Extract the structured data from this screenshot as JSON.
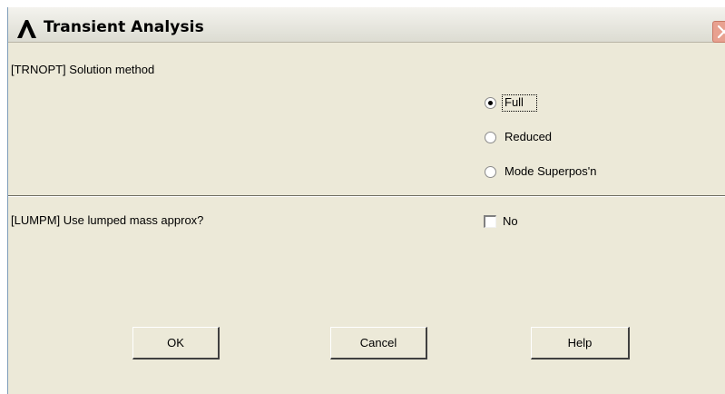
{
  "window": {
    "title": "Transient Analysis"
  },
  "solution_method": {
    "label": "[TRNOPT]  Solution method",
    "options": [
      "Full",
      "Reduced",
      "Mode Superpos'n"
    ],
    "selected": "Full"
  },
  "lumped_mass": {
    "label": "[LUMPM]  Use lumped mass approx?",
    "checkbox_label": "No",
    "checked": false
  },
  "buttons": {
    "ok": "OK",
    "cancel": "Cancel",
    "help": "Help"
  },
  "icons": {
    "logo": "ansys-lambda-logo",
    "close": "close-icon"
  }
}
